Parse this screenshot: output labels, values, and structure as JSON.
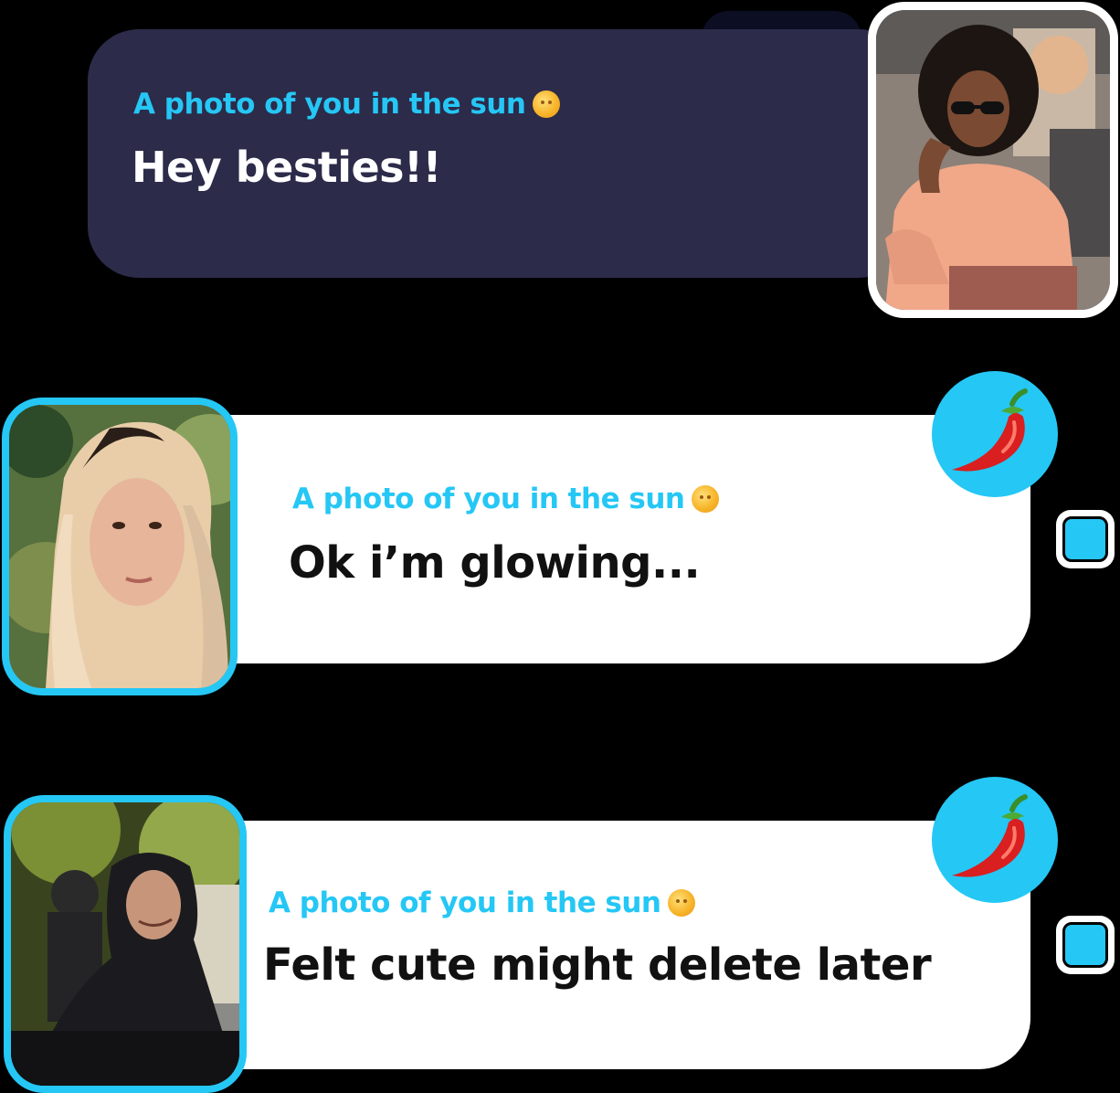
{
  "posts": [
    {
      "prompt": "A photo of you in the sun",
      "prompt_icon": "sun-face-icon",
      "message": "Hey besties!!",
      "card_color": "#2c2b4a",
      "prompt_color": "#25c7f5",
      "avatar": "photo-woman-sunglasses"
    },
    {
      "prompt": "A photo of you in the sun",
      "prompt_icon": "sun-face-icon",
      "message": "Ok i’m glowing...",
      "card_color": "#ffffff",
      "reaction_icon": "chili-pepper-icon",
      "avatar": "photo-woman-blonde-hair"
    },
    {
      "prompt": "A photo of you in the sun",
      "prompt_icon": "sun-face-icon",
      "message": "Felt cute might delete later",
      "card_color": "#ffffff",
      "reaction_icon": "chili-pepper-icon",
      "avatar": "photo-person-hoodie"
    }
  ],
  "accent_color": "#25c7f5"
}
